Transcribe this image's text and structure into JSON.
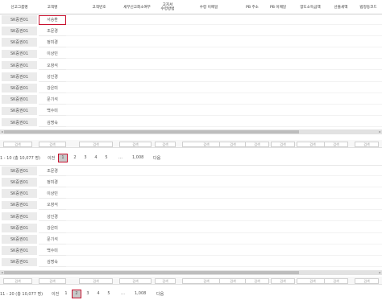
{
  "headers": [
    "신고그룹명",
    "고객명",
    "고객번호",
    "세무신고회소여부",
    "고지서\n수령방법",
    "수령 이메일",
    "PB 주소",
    "PB 이메일",
    "양도소득금액",
    "산출세액",
    "법정동코드"
  ],
  "filter_label": "검색",
  "group_name": "SK증권01",
  "grid1": {
    "customers": [
      "서승환",
      "조문경",
      "정미경",
      "이상민",
      "오창석",
      "성인경",
      "강은미",
      "문기석",
      "백수미",
      "김명숙"
    ]
  },
  "pager1": {
    "info": "1 - 10 (총 10,077 명)",
    "prev": "이전",
    "pages": [
      "1",
      "2",
      "3",
      "4",
      "5"
    ],
    "active": "1",
    "dots": "…",
    "last": "1,008",
    "next": "다음"
  },
  "grid2": {
    "customers": [
      "조문경",
      "정미경",
      "이상민",
      "오창석",
      "성인경",
      "강은미",
      "문기석",
      "백수미",
      "김명숙"
    ]
  },
  "pager2": {
    "info": "11 - 20 (총 10,077 명)",
    "prev": "이전",
    "pages": [
      "1",
      "2",
      "3",
      "4",
      "5"
    ],
    "active": "2",
    "dots": "…",
    "last": "1,008",
    "next": "다음"
  }
}
